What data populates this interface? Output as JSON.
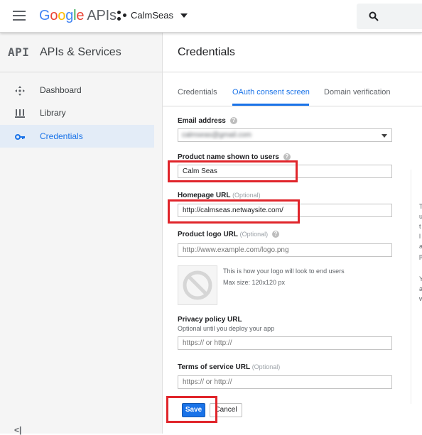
{
  "topbar": {
    "brand": "Google",
    "product": "APIs",
    "project_name": "CalmSeas"
  },
  "sidebar": {
    "api_mark": "API",
    "title": "APIs & Services",
    "items": [
      {
        "label": "Dashboard",
        "icon": "dashboard-icon"
      },
      {
        "label": "Library",
        "icon": "library-icon"
      },
      {
        "label": "Credentials",
        "icon": "key-icon",
        "active": true
      }
    ],
    "collapse_label": "<|"
  },
  "page": {
    "title": "Credentials",
    "tabs": [
      "Credentials",
      "OAuth consent screen",
      "Domain verification"
    ],
    "active_tab": "OAuth consent screen"
  },
  "form": {
    "email": {
      "label": "Email address",
      "value": "calmseas@gmail.com"
    },
    "product_name": {
      "label": "Product name shown to users",
      "value": "Calm Seas"
    },
    "homepage": {
      "label": "Homepage URL",
      "optional": "(Optional)",
      "value": "http://calmseas.netwaysite.com/"
    },
    "logo_url": {
      "label": "Product logo URL",
      "optional": "(Optional)",
      "placeholder": "http://www.example.com/logo.png"
    },
    "logo_preview": {
      "line1": "This is how your logo will look to end users",
      "line2": "Max size: 120x120 px"
    },
    "privacy": {
      "label": "Privacy policy URL",
      "hint": "Optional until you deploy your app",
      "placeholder": "https:// or http://"
    },
    "terms": {
      "label": "Terms of service URL",
      "optional": "(Optional)",
      "placeholder": "https:// or http://"
    },
    "save_label": "Save",
    "cancel_label": "Cancel"
  },
  "right_panel_fragments": [
    "T",
    "u",
    "t",
    "l",
    "a",
    "p",
    "Y",
    "a",
    "w"
  ],
  "colors": {
    "accent": "#1a73e8",
    "highlight": "#e0252b"
  }
}
